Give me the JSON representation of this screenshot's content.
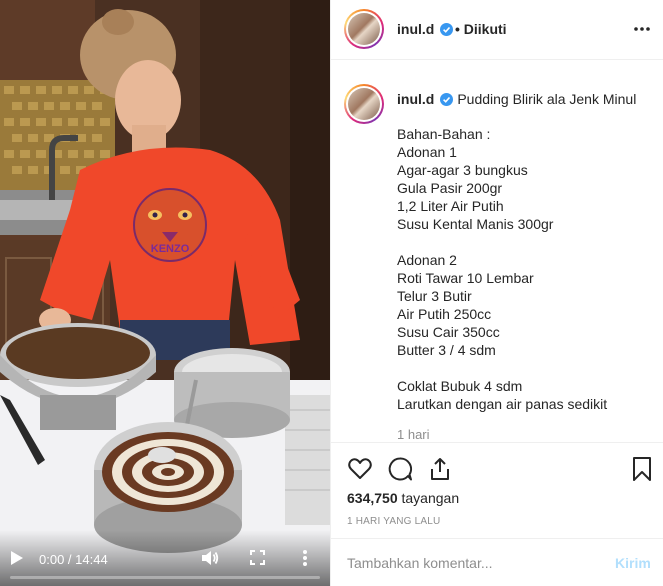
{
  "video": {
    "time_display": "0:00 / 14:44",
    "progress": 0,
    "sweater_logo_text": "KENZO"
  },
  "header": {
    "username": "inul.d",
    "separator": "•",
    "follow_status": "Diikuti",
    "avatar_icon": "profile-avatar",
    "more_icon": "more-horizontal-icon"
  },
  "caption": {
    "username": "inul.d",
    "title": "Pudding Blirik ala Jenk Minul",
    "lines": [
      "Bahan-Bahan :",
      "Adonan 1",
      "Agar-agar 3 bungkus",
      "Gula Pasir 200gr",
      "1,2 Liter Air Putih",
      "Susu Kental Manis 300gr",
      "",
      "Adonan 2",
      "Roti Tawar 10 Lembar",
      "Telur 3 Butir",
      "Air Putih 250cc",
      "Susu Cair 350cc",
      "Butter 3 / 4 sdm",
      "",
      "Coklat Bubuk 4 sdm",
      "Larutkan dengan air panas sedikit"
    ],
    "time_ago": "1 hari"
  },
  "actions": {
    "views_count": "634,750",
    "views_label": "tayangan",
    "post_date": "1 HARI YANG LALU"
  },
  "comment": {
    "placeholder": "Tambahkan komentar...",
    "post_label": "Kirim"
  },
  "colors": {
    "verified_blue": "#3897f0",
    "post_button_disabled": "#b2dffc",
    "muted_text": "#8e8e8e",
    "sweater_red": "#f0482a"
  }
}
